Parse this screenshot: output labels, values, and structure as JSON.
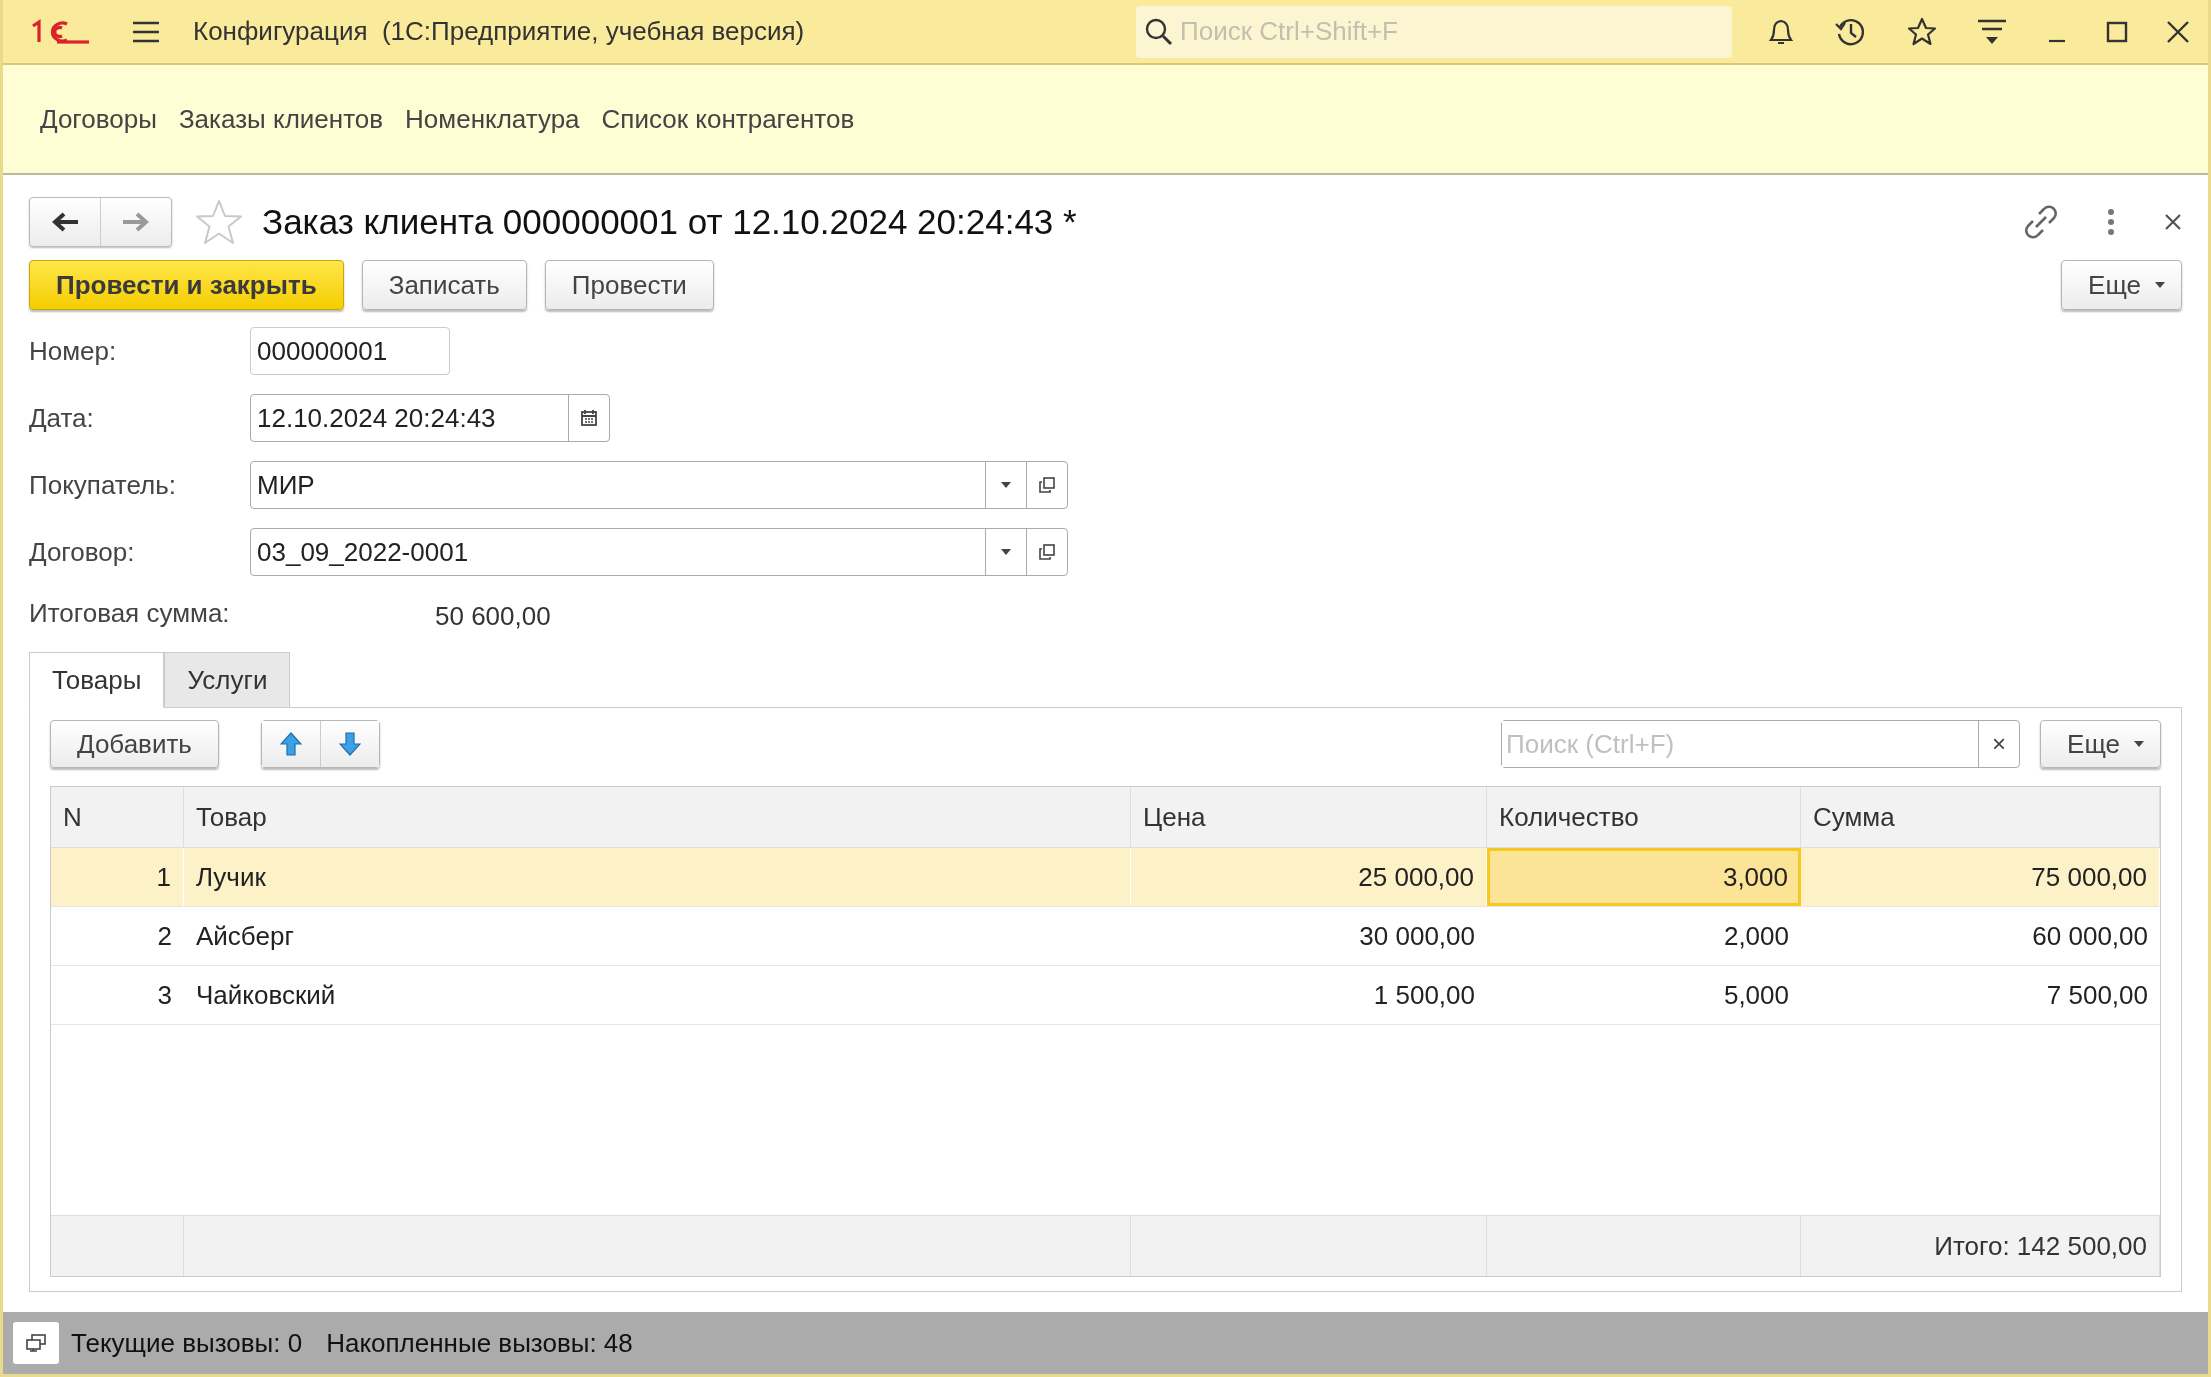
{
  "window": {
    "title": "Конфигурация  (1С:Предприятие, учебная версия)",
    "search": {
      "placeholder": "Поиск Ctrl+Shift+F"
    }
  },
  "sections": [
    {
      "label": "Договоры"
    },
    {
      "label": "Заказы клиентов"
    },
    {
      "label": "Номенклатура"
    },
    {
      "label": "Список контрагентов"
    }
  ],
  "form": {
    "title": "Заказ клиента 000000001 от 12.10.2024 20:24:43 *",
    "buttons": [
      {
        "label": "Провести и закрыть",
        "kind": "primary"
      },
      {
        "label": "Записать",
        "kind": "normal"
      },
      {
        "label": "Провести",
        "kind": "normal"
      }
    ],
    "more": "Еще",
    "fields": [
      {
        "label": "Номер:",
        "value": "000000001",
        "kind": "text"
      },
      {
        "label": "Дата:",
        "value": "12.10.2024 20:24:43",
        "kind": "date"
      },
      {
        "label": "Покупатель:",
        "value": "МИР",
        "kind": "ref"
      },
      {
        "label": "Договор:",
        "value": "03_09_2022-0001",
        "kind": "ref"
      }
    ],
    "total": {
      "label": "Итоговая сумма:",
      "value": "50 600,00"
    },
    "tabs": [
      {
        "label": "Товары",
        "selected": true
      },
      {
        "label": "Услуги",
        "selected": false
      }
    ],
    "table_toolbar": {
      "add": "Добавить",
      "search": {
        "placeholder": "Поиск (Ctrl+F)",
        "clear": "×"
      },
      "more": "Еще"
    },
    "table": {
      "columns": [
        "N",
        "Товар",
        "Цена",
        "Количество",
        "Сумма"
      ],
      "rows": [
        {
          "n": "1",
          "item": "Лучик",
          "price": "25 000,00",
          "qty": "3,000",
          "sum": "75 000,00",
          "selected": true
        },
        {
          "n": "2",
          "item": "Айсберг",
          "price": "30 000,00",
          "qty": "2,000",
          "sum": "60 000,00",
          "selected": false
        },
        {
          "n": "3",
          "item": "Чайковский",
          "price": "1 500,00",
          "qty": "5,000",
          "sum": "7 500,00",
          "selected": false
        }
      ],
      "footer_total": "Итого: 142 500,00"
    }
  },
  "status_bar": {
    "current": "Текущие вызовы: 0",
    "accumulated": "Накопленные вызовы: 48"
  }
}
